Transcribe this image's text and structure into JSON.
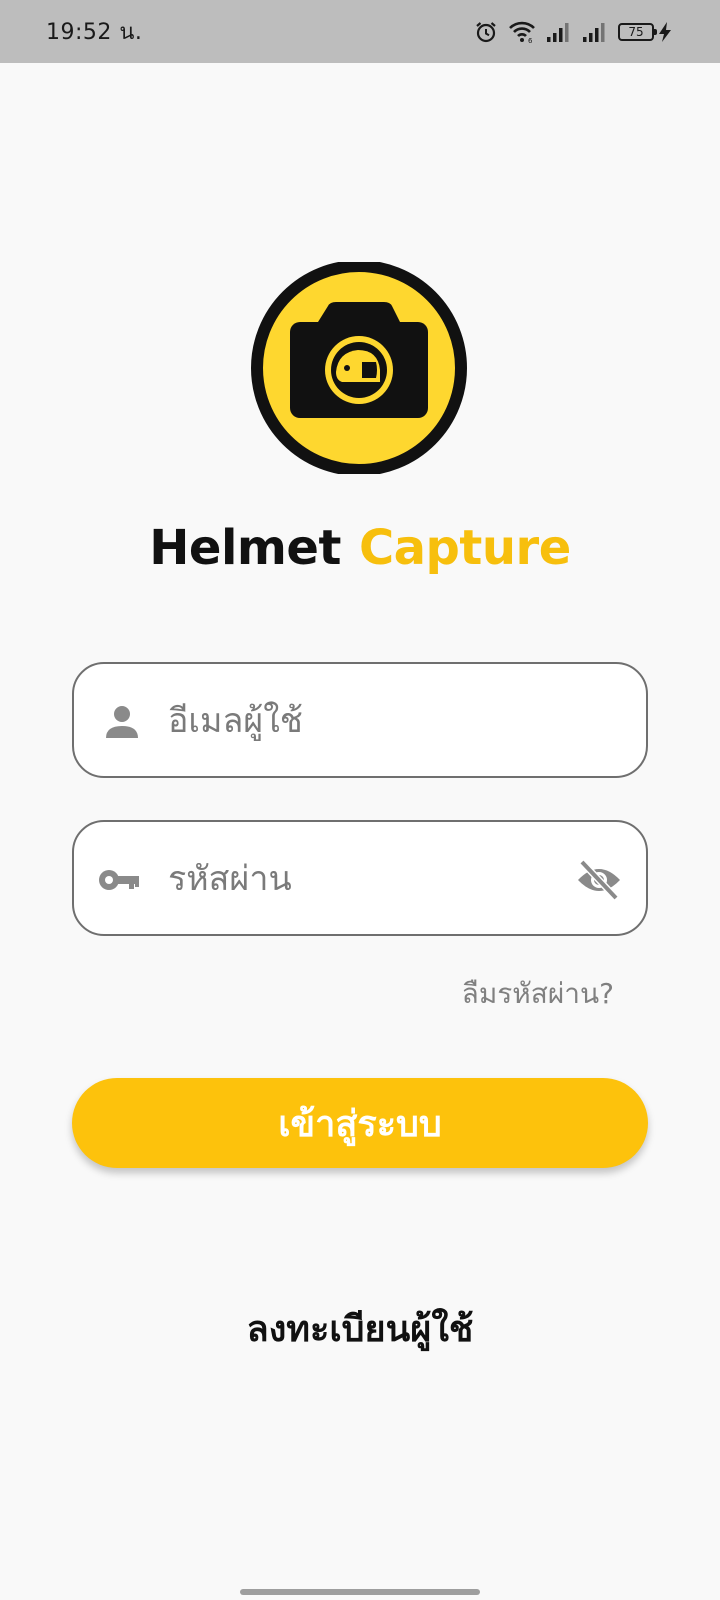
{
  "status_bar": {
    "time": "19:52 น.",
    "battery": "75",
    "icons": [
      "alarm-icon",
      "wifi-icon",
      "signal-icon",
      "signal-icon",
      "battery-icon",
      "charging-icon"
    ]
  },
  "app": {
    "title_part1": "Helmet",
    "title_part2": "Capture",
    "logo_icon": "camera-helmet-logo",
    "accent_color": "#fdc20c"
  },
  "login_form": {
    "email_placeholder": "อีเมลผู้ใช้",
    "password_placeholder": "รหัสผ่าน",
    "forgot_password": "ลืมรหัสผ่าน?",
    "login_button": "เข้าสู่ระบบ",
    "register_link": "ลงทะเบียนผู้ใช้"
  }
}
